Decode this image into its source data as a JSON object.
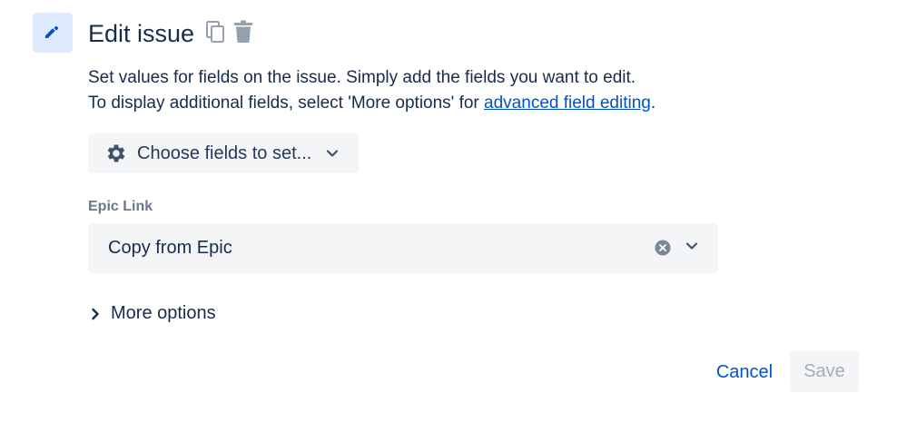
{
  "header": {
    "title": "Edit issue",
    "icons": [
      "pencil-icon",
      "copy-icon",
      "trash-icon"
    ]
  },
  "description": {
    "line1": "Set values for fields on the issue. Simply add the fields you want to edit.",
    "line2_prefix": "To display additional fields, select 'More options' for ",
    "line2_link": "advanced field editing",
    "line2_suffix": "."
  },
  "choose_fields": {
    "label": "Choose fields to set...",
    "icon": "gear-icon"
  },
  "epic_link": {
    "label": "Epic Link",
    "value": "Copy from Epic"
  },
  "more_options": {
    "label": "More options"
  },
  "actions": {
    "cancel_label": "Cancel",
    "save_label": "Save"
  },
  "colors": {
    "accent": "#0052cc",
    "badge_bg": "#deebff",
    "field_bg": "#f4f5f7",
    "text": "#172b4d",
    "muted": "#6b778c",
    "disabled": "#a5adba"
  }
}
